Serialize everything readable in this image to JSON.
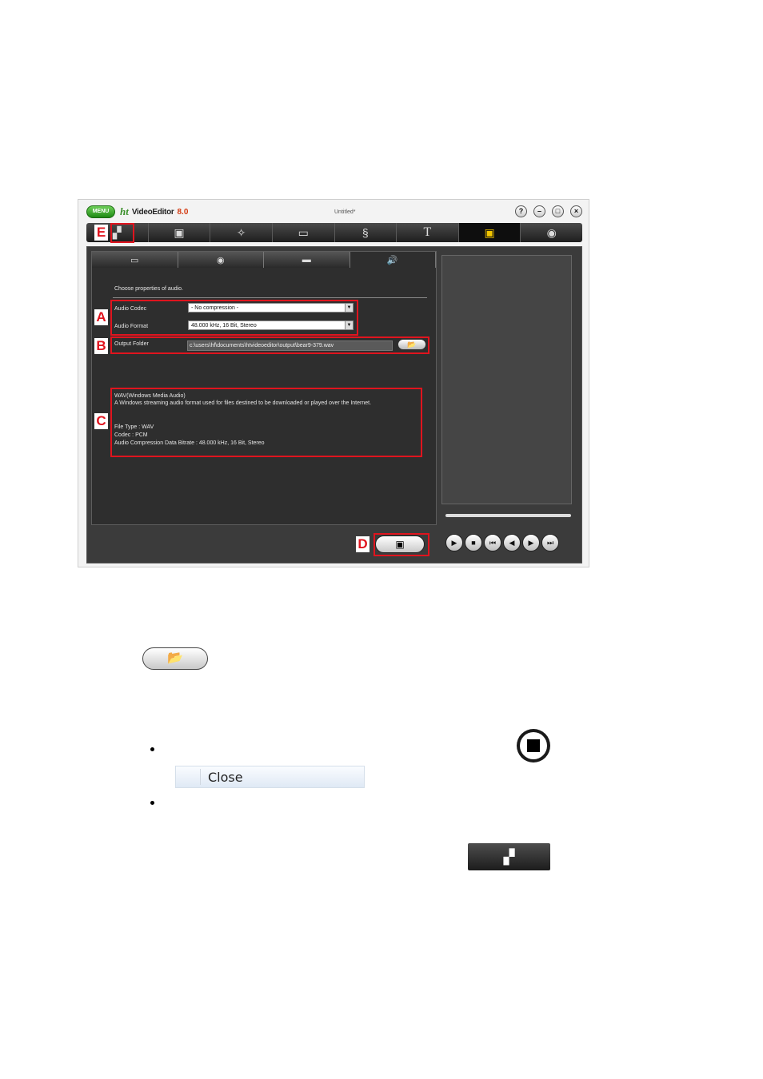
{
  "app": {
    "menu_label": "MENU",
    "logo_brand": "ht",
    "logo_name": "VideoEditor",
    "logo_version": "8.0",
    "doc_title": "Untitled*",
    "window_buttons": [
      "?",
      "–",
      "□",
      "×"
    ]
  },
  "toolbar": {
    "items": [
      {
        "icon": "new-project-icon",
        "glyph": "▞"
      },
      {
        "icon": "media-import-icon",
        "glyph": "▣"
      },
      {
        "icon": "effects-wand-icon",
        "glyph": "✧"
      },
      {
        "icon": "storyboard-icon",
        "glyph": "▭"
      },
      {
        "icon": "transition-icon",
        "glyph": "§"
      },
      {
        "icon": "text-icon",
        "glyph": "T"
      },
      {
        "icon": "save-output-icon",
        "glyph": "▣"
      },
      {
        "icon": "disc-burn-icon",
        "glyph": "◉"
      }
    ],
    "active_index": 6
  },
  "subtabs": [
    {
      "icon": "film-strip-icon",
      "glyph": "▭"
    },
    {
      "icon": "disc-icon",
      "glyph": "◉"
    },
    {
      "icon": "device-icon",
      "glyph": "▬"
    },
    {
      "icon": "speaker-icon",
      "glyph": "🔊"
    }
  ],
  "audio": {
    "section_title": "Choose properties of audio.",
    "codec_label": "Audio Codec",
    "codec_value": "- No compression -",
    "format_label": "Audio Format",
    "format_value": "48.000 kHz, 16 Bit, Stereo",
    "folder_label": "Output Folder",
    "folder_value": "c:\\users\\hf\\documents\\htvideoeditor\\output\\bear9-379.wav"
  },
  "info": {
    "line1": "WAV(Windows Media Audio)",
    "line2": "A Windows streaming audio format used for files destined to be downloaded or played over the Internet.",
    "line3": "File Type : WAV",
    "line4": "Codec : PCM",
    "line5": "Audio Compression Data Bitrate : 48.000 kHz, 16 Bit, Stereo"
  },
  "callouts": {
    "a": "A",
    "b": "B",
    "c": "C",
    "d": "D",
    "e": "E"
  },
  "player": {
    "controls": [
      "▶",
      "■",
      "⏮",
      "◀",
      "▶",
      "⏭"
    ]
  },
  "doc": {
    "close_label": "Close"
  },
  "colors": {
    "accent": "#f2c500",
    "callout": "#e0141e"
  }
}
